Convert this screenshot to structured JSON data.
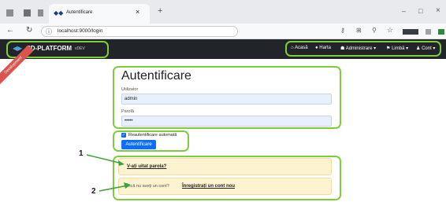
{
  "browser": {
    "tab_title": "Autentificare",
    "tab_close": "×",
    "new_tab": "+",
    "url": "localhost:9000/login",
    "window_min": "–",
    "window_max": "□",
    "window_close": "×"
  },
  "navbar": {
    "brand": "CD-PLATFORM",
    "version": "vDEV",
    "items": [
      {
        "icon": "home-icon",
        "label": "Acasă"
      },
      {
        "icon": "map-pin-icon",
        "label": "Harta"
      },
      {
        "icon": "users-icon",
        "label": "Administrare"
      },
      {
        "icon": "flag-icon",
        "label": "Limbă"
      },
      {
        "icon": "user-icon",
        "label": "Cont"
      }
    ]
  },
  "ribbon": "Development",
  "login": {
    "title": "Autentificare",
    "username_label": "Utilizator",
    "username_value": "admin",
    "password_label": "Parolă",
    "password_value": "•••••",
    "remember_label": "Reautentificare automată",
    "submit_label": "Autentificare"
  },
  "forgot": {
    "link": "V-ați uitat parola?"
  },
  "register": {
    "prompt": "Încă nu aveți un cont?",
    "link": "Înregistrați un cont nou"
  },
  "annotations": {
    "one": "1",
    "two": "2"
  },
  "colors": {
    "highlight": "#7fcd3a",
    "navbar": "#212529",
    "primary": "#0d6efd",
    "alert": "#fdf3d0"
  }
}
